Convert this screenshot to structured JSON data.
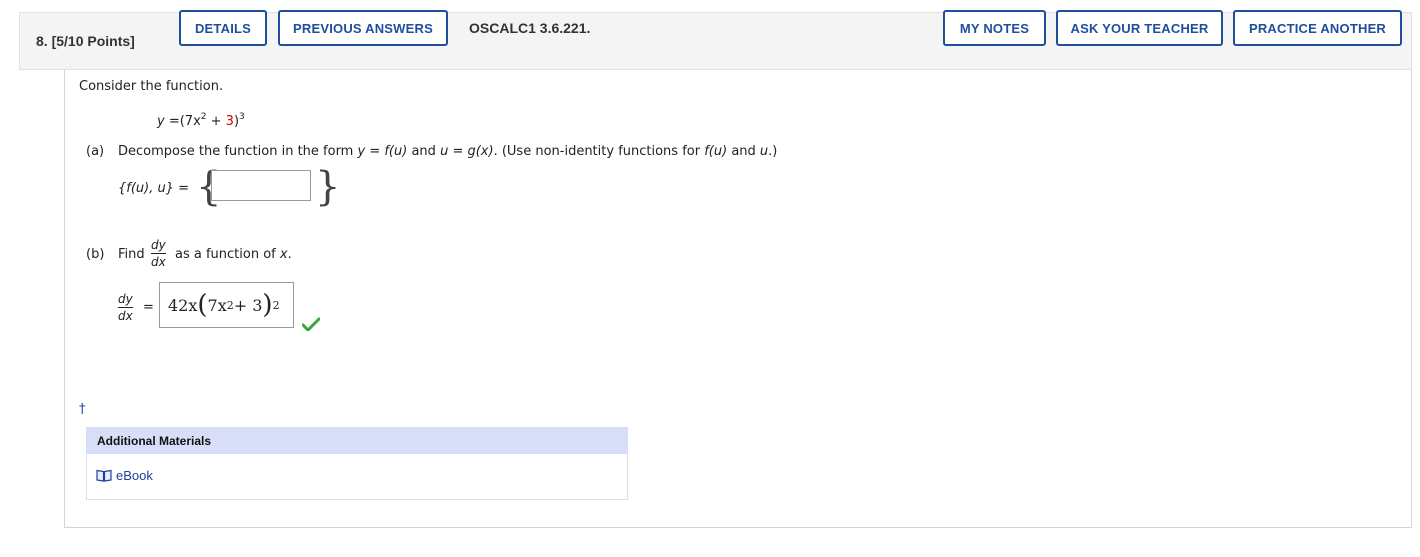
{
  "header": {
    "question_number": "8.",
    "points": "[5/10 Points]",
    "details_label": "DETAILS",
    "previous_answers_label": "PREVIOUS ANSWERS",
    "question_id": "OSCALC1 3.6.221.",
    "my_notes_label": "MY NOTES",
    "ask_teacher_label": "ASK YOUR TEACHER",
    "practice_another_label": "PRACTICE ANOTHER"
  },
  "content": {
    "intro": "Consider the function.",
    "function_y": "y",
    "function_eq": " =(7x",
    "function_exp2": "2",
    "function_plus": " + ",
    "function_three": "3",
    "function_close": ")",
    "function_exp3": "3",
    "part_a": {
      "label": "(a)",
      "text_1": "Decompose the function in the form ",
      "text_y": "y",
      "text_eq1": " = ",
      "text_fu": "f(u)",
      "text_and": " and ",
      "text_u": "u",
      "text_eq2": " = ",
      "text_gx": "g(x)",
      "text_2": ". (Use non-identity functions for ",
      "text_fu2": "f(u)",
      "text_and2": " and ",
      "text_u2": "u",
      "text_3": ".)",
      "set_label": "{f(u), u}",
      "set_eq": " =",
      "answer_value": ""
    },
    "part_b": {
      "label": "(b)",
      "find": "Find",
      "frac_num": "dy",
      "frac_den": "dx",
      "as_function": "as a function of",
      "var_x": "x",
      "period": ".",
      "eq": "=",
      "answer_coeff": "42x",
      "answer_inner": "7x",
      "answer_inner_exp": "2",
      "answer_plus": " + 3",
      "answer_exp": "2",
      "status": "correct"
    },
    "dagger": "†"
  },
  "additional_materials": {
    "title": "Additional Materials",
    "ebook_label": "eBook"
  },
  "colors": {
    "button_border": "#1f4e9b",
    "highlight_red": "#d40000",
    "correct_green": "#3aa63a",
    "materials_header": "#d9def8"
  },
  "icons": {
    "check": "checkmark-icon",
    "ebook": "book-icon"
  }
}
